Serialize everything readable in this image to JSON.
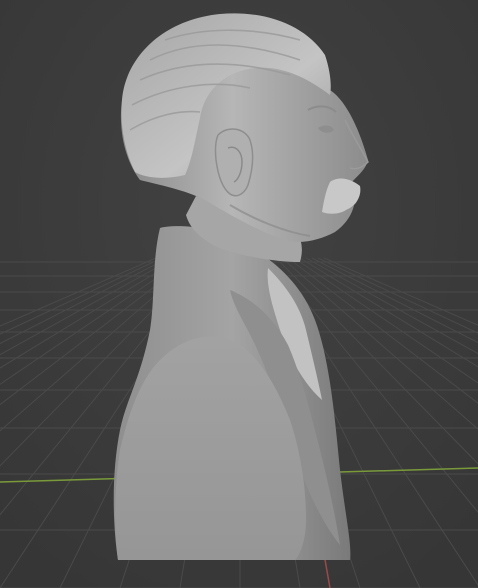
{
  "viewport": {
    "background_color": "#3b3b3b",
    "grid_color": "#4a4a4a",
    "x_axis_color": "#7a9a3a",
    "y_axis_color": "#9a4a4a",
    "model_base_color": "#a8a8a8",
    "model_section_color": "#9c9c9c"
  }
}
